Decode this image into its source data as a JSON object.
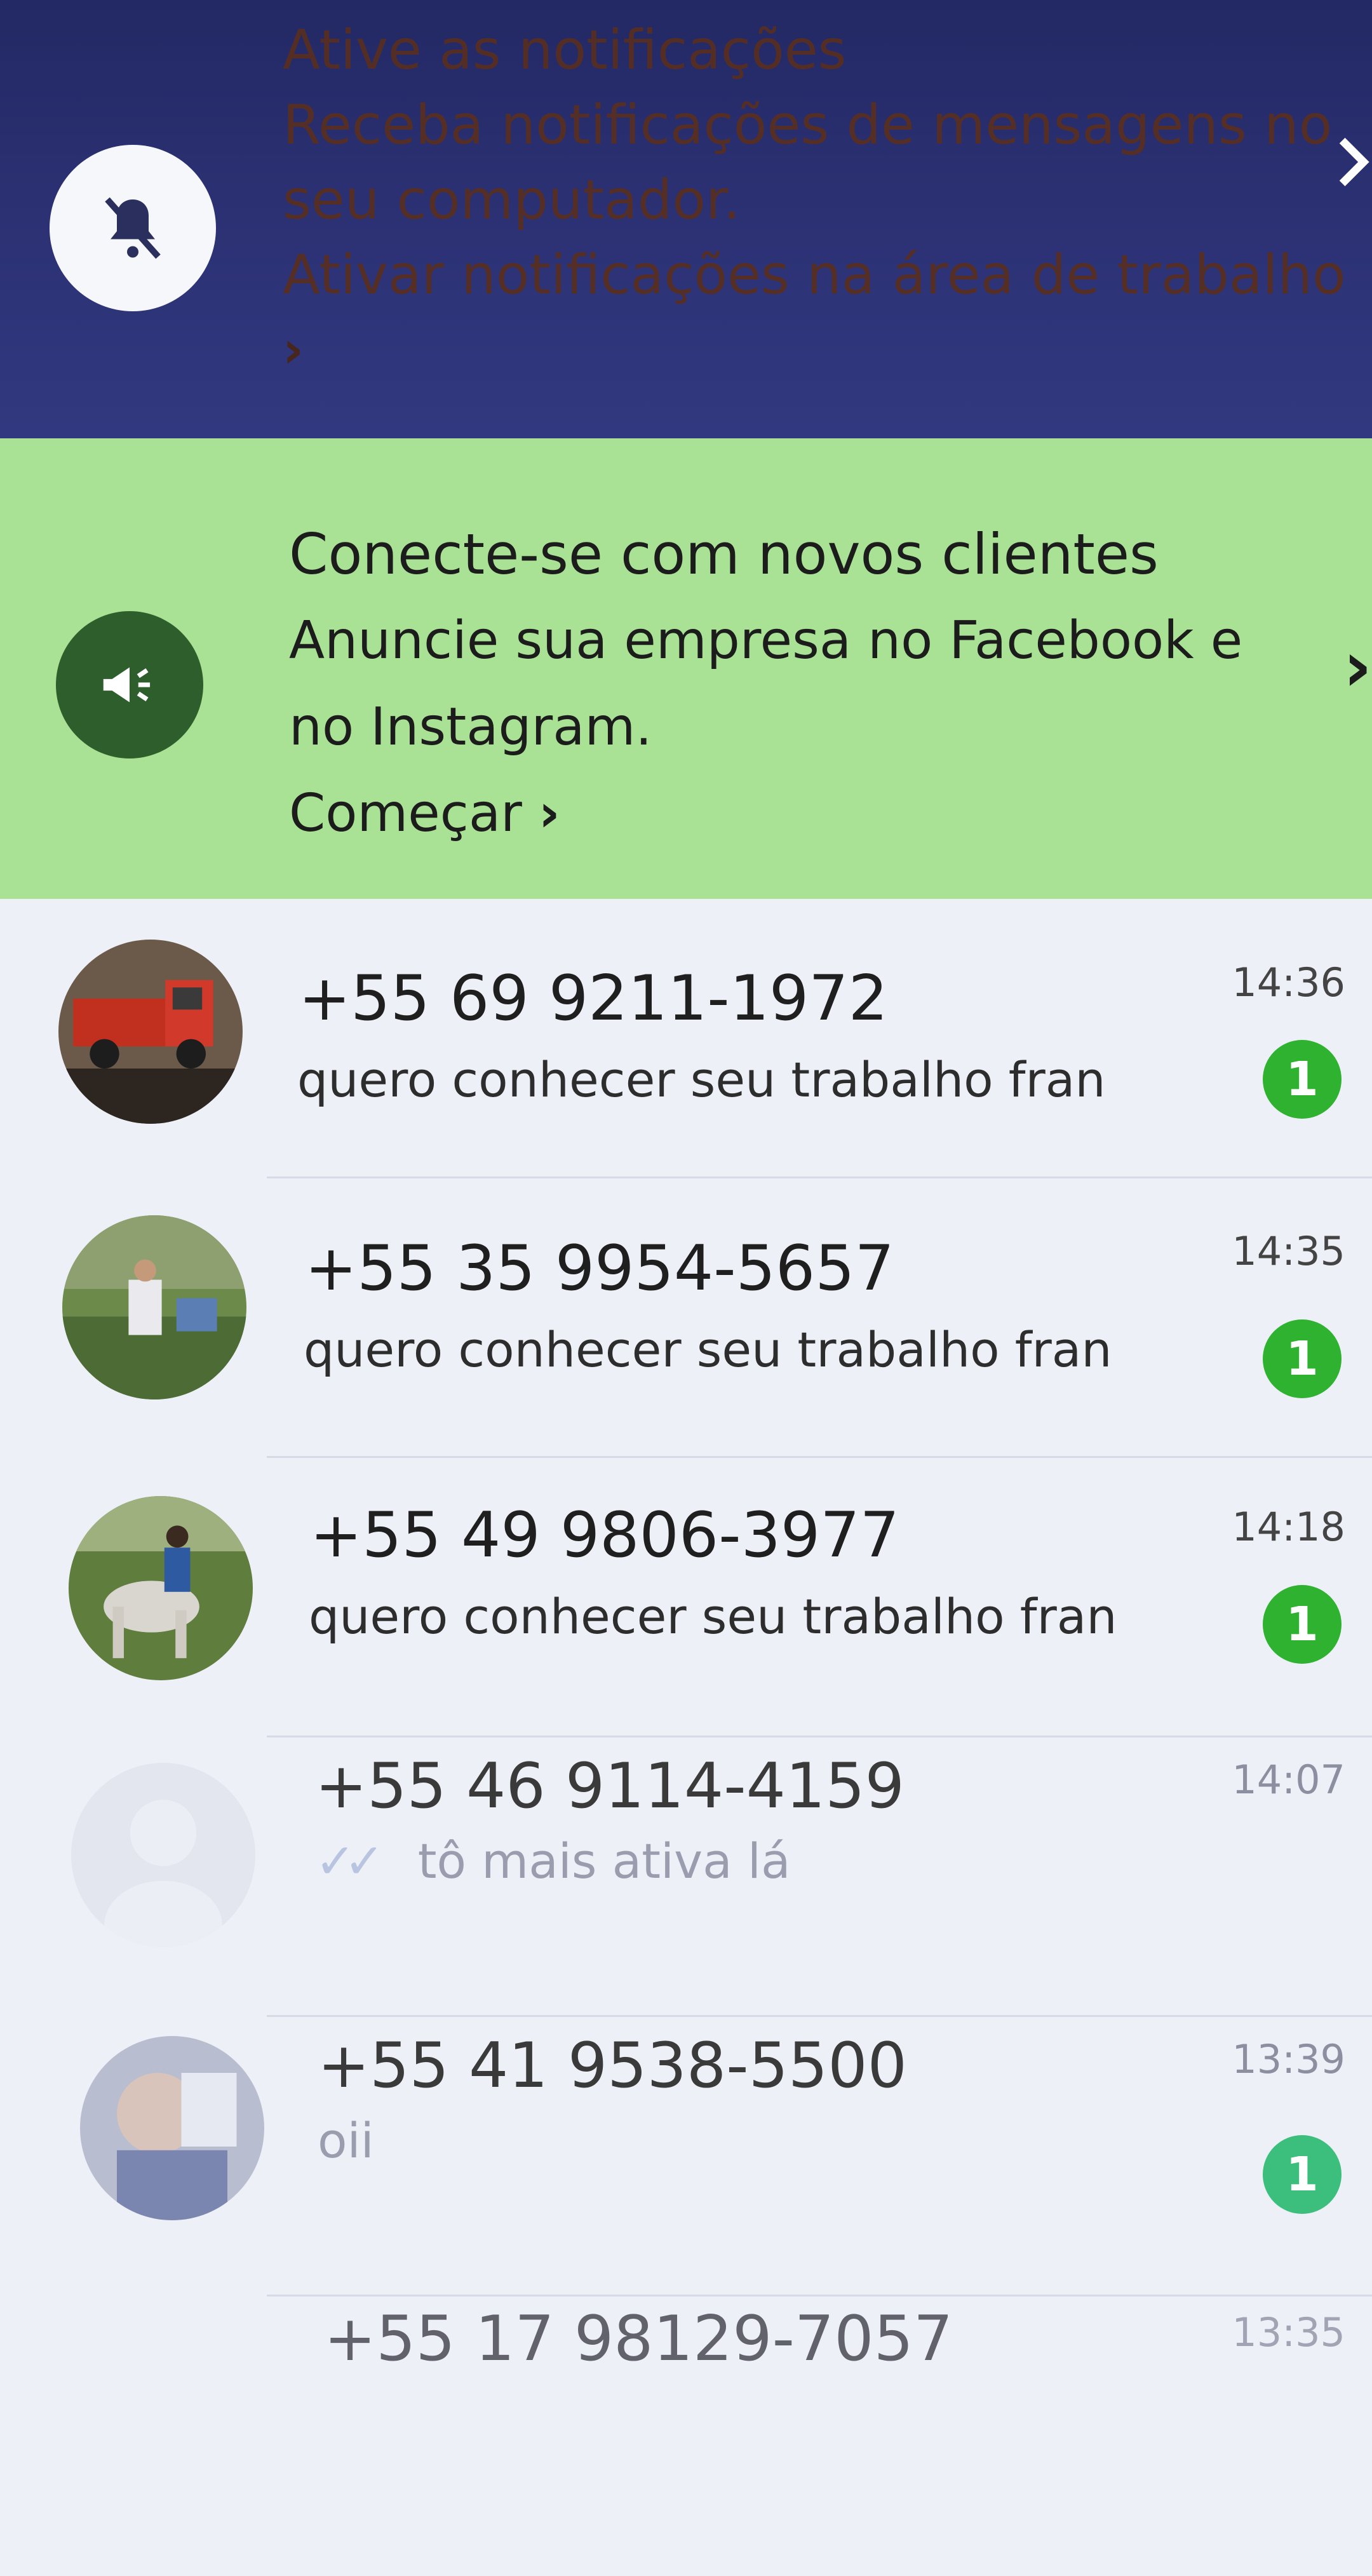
{
  "notification_banner": {
    "title": "Ative as notificações",
    "description_line1": "Receba notificações de mensagens no",
    "description_line2": "seu computador.",
    "link": "Ativar notificações na área de trabalho",
    "link_chevron": "›",
    "close_icon": "close-icon",
    "icon": "bell-off-icon"
  },
  "promo_banner": {
    "title": "Conecte-se com novos clientes",
    "description_line1": "Anuncie sua empresa no Facebook e",
    "description_line2": "no Instagram.",
    "cta": "Começar",
    "cta_chevron": "›",
    "icon": "megaphone-icon",
    "dismiss_chevron": "›"
  },
  "chats": [
    {
      "name": "+55 69 9211-1972",
      "preview": "quero conhecer seu trabalho fran",
      "time": "14:36",
      "unread": "1",
      "avatar": "red-truck-photo"
    },
    {
      "name": "+55 35 9954-5657",
      "preview": "quero conhecer seu trabalho fran",
      "time": "14:35",
      "unread": "1",
      "avatar": "outdoor-photo"
    },
    {
      "name": "+55 49 9806-3977",
      "preview": "quero conhecer seu trabalho fran",
      "time": "14:18",
      "unread": "1",
      "avatar": "horse-rider-photo"
    },
    {
      "name": "+55 46 9114-4159",
      "preview": "tô mais ativa lá",
      "time": "14:07",
      "unread": "",
      "avatar": "default-avatar"
    },
    {
      "name": "+55 41 9538-5500",
      "preview": "oii",
      "time": "13:39",
      "unread": "1",
      "avatar": "portrait-photo"
    },
    {
      "name": "+55 17 98129-7057",
      "preview": "",
      "time": "13:35",
      "unread": "",
      "avatar": "default-avatar"
    }
  ],
  "colors": {
    "notification_bg": "#2b3173",
    "promo_bg": "#a9e294",
    "unread_badge": "#2fb22f",
    "list_bg": "#eef0f8"
  }
}
